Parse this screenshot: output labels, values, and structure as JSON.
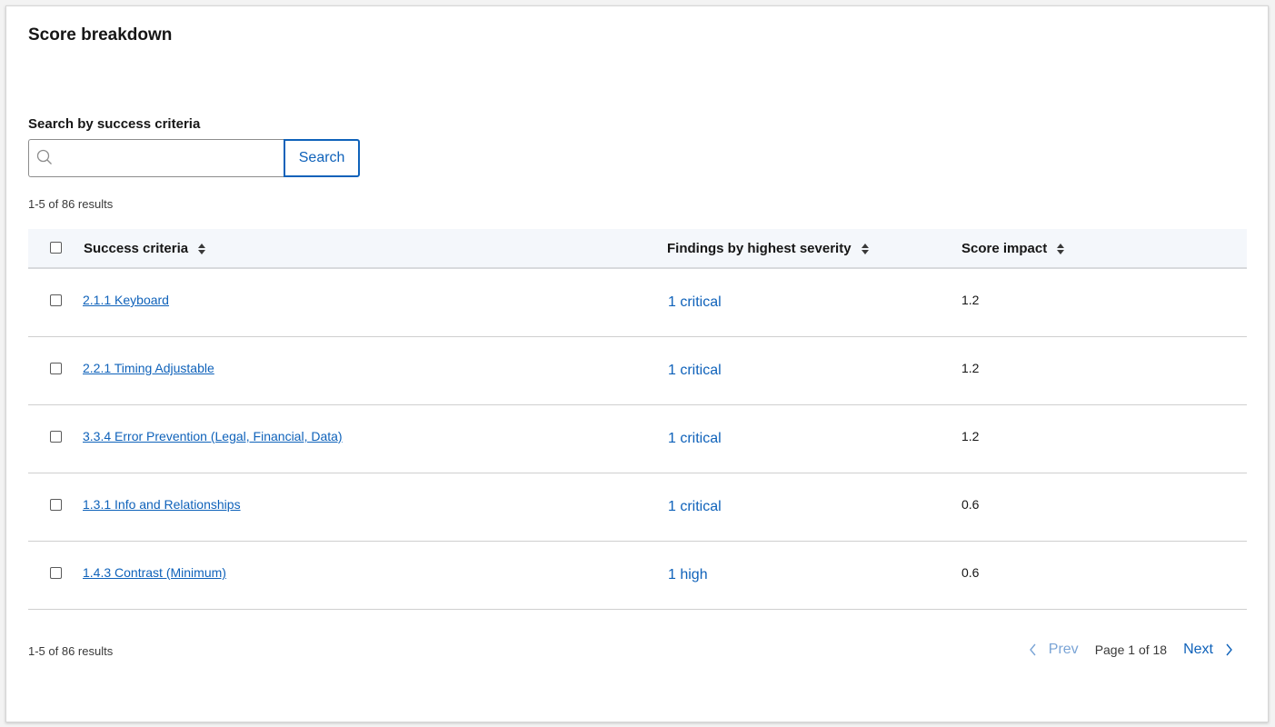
{
  "title": "Score breakdown",
  "search": {
    "label": "Search by success criteria",
    "placeholder": "",
    "value": "",
    "button_label": "Search"
  },
  "results_summary": "1-5 of 86 results",
  "table": {
    "headers": {
      "criteria": "Success criteria",
      "severity": "Findings by highest severity",
      "impact": "Score impact"
    },
    "rows": [
      {
        "criteria": "2.1.1 Keyboard",
        "severity": "1 critical",
        "impact": "1.2"
      },
      {
        "criteria": "2.2.1 Timing Adjustable",
        "severity": "1 critical",
        "impact": "1.2"
      },
      {
        "criteria": "3.3.4 Error Prevention (Legal, Financial, Data)",
        "severity": "1 critical",
        "impact": "1.2"
      },
      {
        "criteria": "1.3.1 Info and Relationships",
        "severity": "1 critical",
        "impact": "0.6"
      },
      {
        "criteria": "1.4.3 Contrast (Minimum)",
        "severity": "1 high",
        "impact": "0.6"
      }
    ]
  },
  "pagination": {
    "prev_label": "Prev",
    "page_label": "Page 1 of 18",
    "next_label": "Next"
  },
  "colors": {
    "link": "#0f62ba",
    "header_bg": "#f4f7fb"
  },
  "icons": {
    "search": "search-icon",
    "sort": "sort-icon",
    "prev": "chevron-left-icon",
    "next": "chevron-right-icon"
  }
}
